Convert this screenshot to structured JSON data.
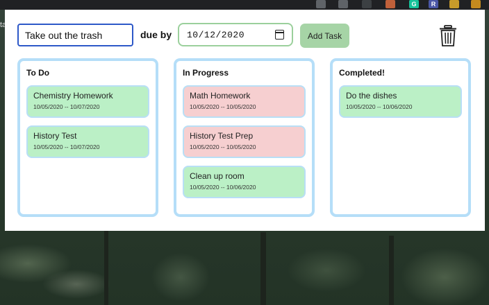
{
  "browser": {
    "extensions": [
      {
        "name": "shield-icon",
        "label": "",
        "color": "#5f6368"
      },
      {
        "name": "pin-icon",
        "label": "",
        "color": "#5f6368"
      },
      {
        "name": "extension-icon",
        "label": "",
        "color": "#3c4043"
      },
      {
        "name": "extension-icon",
        "label": "",
        "color": "#c0603a"
      },
      {
        "name": "grammarly-icon",
        "label": "G",
        "color": "#15c39a"
      },
      {
        "name": "extension-icon",
        "label": "R",
        "color": "#4a56a6"
      },
      {
        "name": "extension-icon",
        "label": "",
        "color": "#c89b2a"
      },
      {
        "name": "extension-icon",
        "label": "",
        "color": "#c48a1e"
      }
    ]
  },
  "form": {
    "task_value": "Take out the trash",
    "due_label": "due by",
    "date_value": "10/12/2020",
    "add_button_label": "Add Task"
  },
  "columns": [
    {
      "title": "To Do",
      "cards": [
        {
          "title": "Chemistry Homework",
          "dates": "10/05/2020 -- 10/07/2020",
          "color": "green"
        },
        {
          "title": "History Test",
          "dates": "10/05/2020 -- 10/07/2020",
          "color": "green"
        }
      ]
    },
    {
      "title": "In Progress",
      "cards": [
        {
          "title": "Math Homework",
          "dates": "10/05/2020 -- 10/05/2020",
          "color": "red"
        },
        {
          "title": "History Test Prep",
          "dates": "10/05/2020 -- 10/05/2020",
          "color": "red"
        },
        {
          "title": "Clean up room",
          "dates": "10/05/2020 -- 10/06/2020",
          "color": "green"
        }
      ]
    },
    {
      "title": "Completed!",
      "cards": [
        {
          "title": "Do the dishes",
          "dates": "10/05/2020 -- 10/06/2020",
          "color": "green"
        }
      ]
    }
  ],
  "colors": {
    "card_green": "#bbf0c6",
    "card_red": "#f6cfd0",
    "column_border": "#b5def8",
    "add_button": "#a6d4a6"
  }
}
